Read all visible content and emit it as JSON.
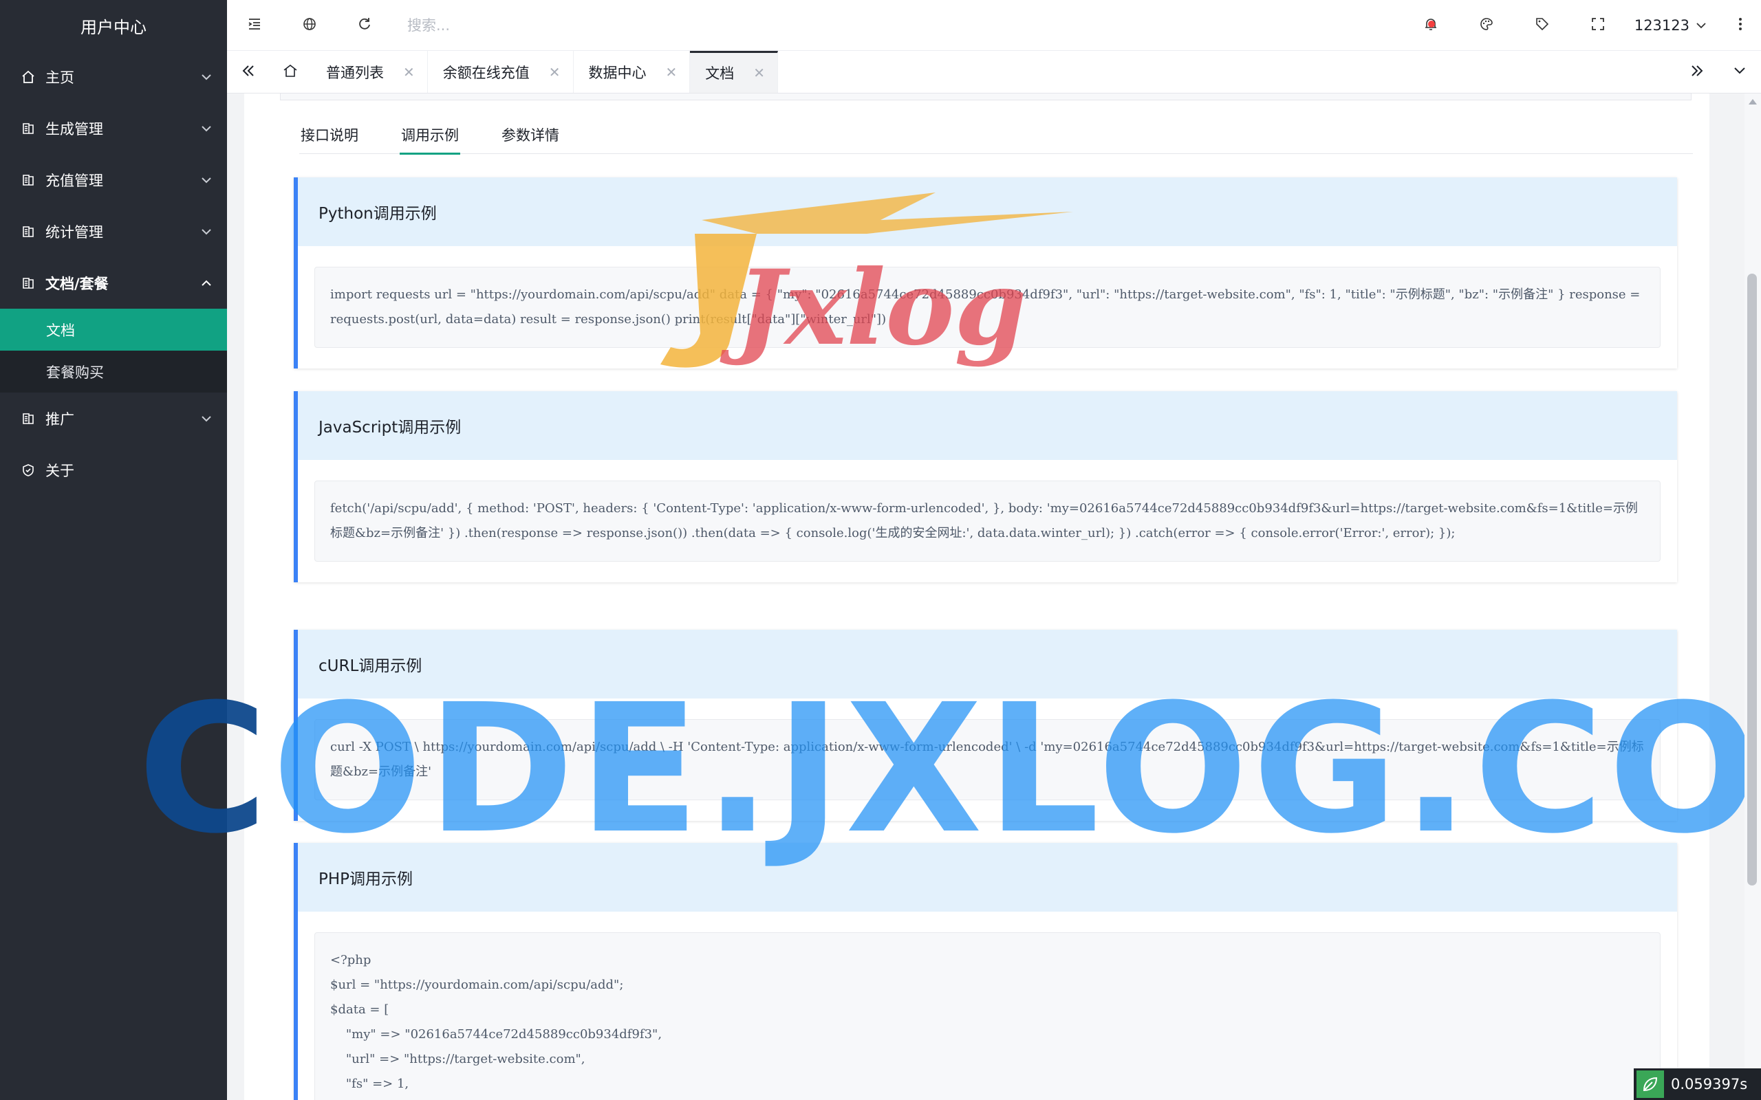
{
  "sidebar": {
    "title": "用户中心",
    "items": [
      {
        "label": "主页"
      },
      {
        "label": "生成管理"
      },
      {
        "label": "充值管理"
      },
      {
        "label": "统计管理"
      },
      {
        "label": "文档/套餐"
      },
      {
        "label": "推广"
      },
      {
        "label": "关于"
      }
    ],
    "sub_items": [
      {
        "label": "文档"
      },
      {
        "label": "套餐购买"
      }
    ]
  },
  "header": {
    "search_placeholder": "搜索...",
    "username": "123123"
  },
  "tabs": [
    {
      "label": "普通列表"
    },
    {
      "label": "余额在线充值"
    },
    {
      "label": "数据中心"
    },
    {
      "label": "文档"
    }
  ],
  "doc_tabs": [
    {
      "label": "接口说明"
    },
    {
      "label": "调用示例"
    },
    {
      "label": "参数详情"
    }
  ],
  "examples": [
    {
      "title": "Python调用示例",
      "code": "import requests url = \"https://yourdomain.com/api/scpu/add\" data = { \"my\": \"02616a5744ce72d45889cc0b934df9f3\", \"url\": \"https://target-website.com\", \"fs\": 1, \"title\": \"示例标题\", \"bz\": \"示例备注\" } response = requests.post(url, data=data) result = response.json() print(result[\"data\"][\"winter_url\"])"
    },
    {
      "title": "JavaScript调用示例",
      "code": "fetch('/api/scpu/add', { method: 'POST', headers: { 'Content-Type': 'application/x-www-form-urlencoded', }, body: 'my=02616a5744ce72d45889cc0b934df9f3&url=https://target-website.com&fs=1&title=示例标题&bz=示例备注' }) .then(response => response.json()) .then(data => { console.log('生成的安全网址:', data.data.winter_url); }) .catch(error => { console.error('Error:', error); });"
    },
    {
      "title": "cURL调用示例",
      "code": "curl -X POST \\ https://yourdomain.com/api/scpu/add \\ -H 'Content-Type: application/x-www-form-urlencoded' \\ -d 'my=02616a5744ce72d45889cc0b934df9f3&url=https://target-website.com&fs=1&title=示例标题&bz=示例备注'"
    },
    {
      "title": "PHP调用示例",
      "code": "<?php\n$url = \"https://yourdomain.com/api/scpu/add\";\n$data = [\n    \"my\" => \"02616a5744ce72d45889cc0b934df9f3\",\n    \"url\" => \"https://target-website.com\",\n    \"fs\" => 1,"
    }
  ],
  "watermark": {
    "logo_text": "Jxlog",
    "site_text_dark": "C",
    "site_text": "ODE.JXLOG.COM"
  },
  "timer": "0.059397s",
  "colors": {
    "sidebar_bg": "#282c34",
    "active_green": "#11a283",
    "example_accent": "#3b82f6",
    "example_header": "#e3f1fc"
  }
}
